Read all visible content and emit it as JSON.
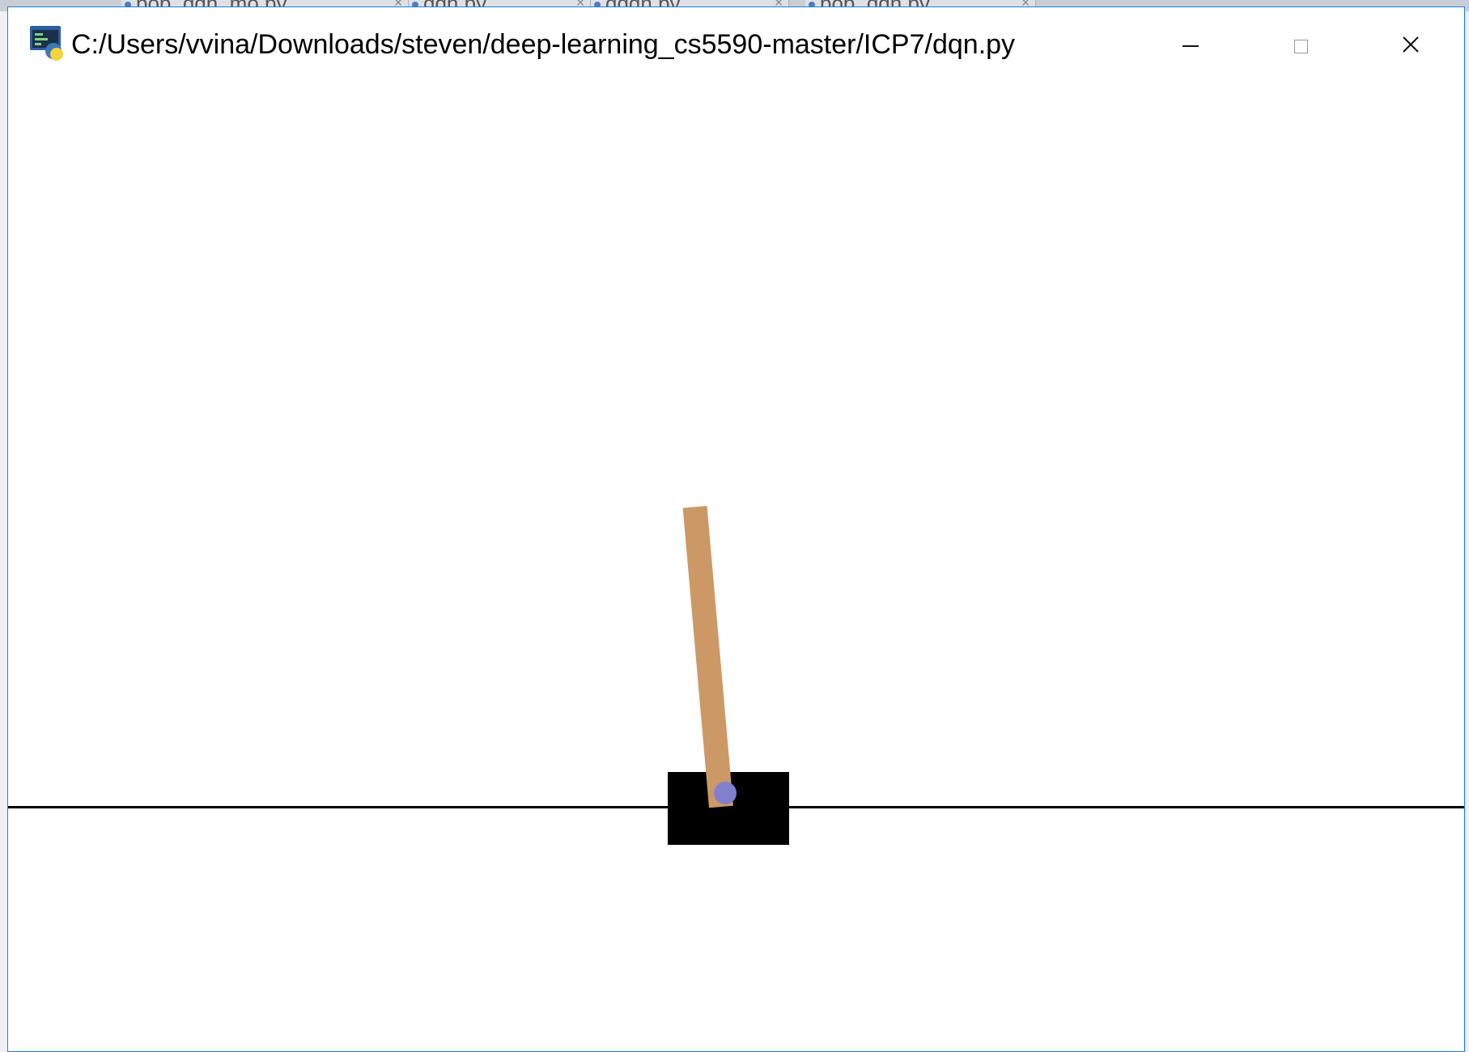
{
  "background_ide": {
    "tabs": [
      "pop_dqn_mo.py",
      "dqn.py",
      "ddqn.py",
      "pop_dqn.py"
    ]
  },
  "window": {
    "title": "C:/Users/vvina/Downloads/steven/deep-learning_cs5590-master/ICP7/dqn.py",
    "icon": "python-icon",
    "controls": {
      "minimize": "minimize-icon",
      "maximize": "maximize-icon",
      "close": "close-icon"
    },
    "accent_color": "#1e7fd6"
  },
  "scene": {
    "environment": "CartPole",
    "colors": {
      "cart": "#000000",
      "pole": "#cc9966",
      "axle": "#8080cc",
      "track": "#000000",
      "background": "#ffffff"
    },
    "pole_angle_deg": -5
  }
}
